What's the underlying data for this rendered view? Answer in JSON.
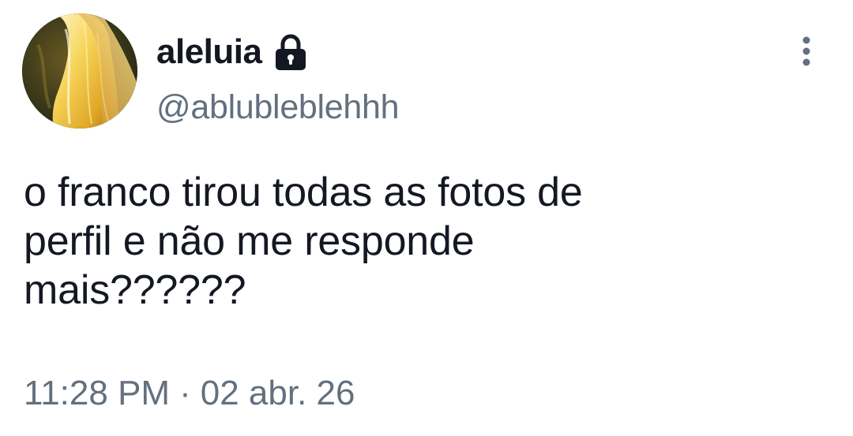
{
  "author": {
    "display_name": "aleluia",
    "handle": "@ablubleblehhh",
    "avatar_icon": "profile-photo-blonde-hair",
    "protected_icon": "lock-icon"
  },
  "menu": {
    "icon": "more-vertical-icon"
  },
  "tweet": {
    "text": "o franco tirou todas as fotos de\nperfil e não me responde\nmais??????"
  },
  "meta": {
    "time": "11:28 PM",
    "separator": "·",
    "date": "02 abr. 26"
  },
  "colors": {
    "primary_text": "#141823",
    "secondary_text": "#627080",
    "background": "#ffffff"
  }
}
